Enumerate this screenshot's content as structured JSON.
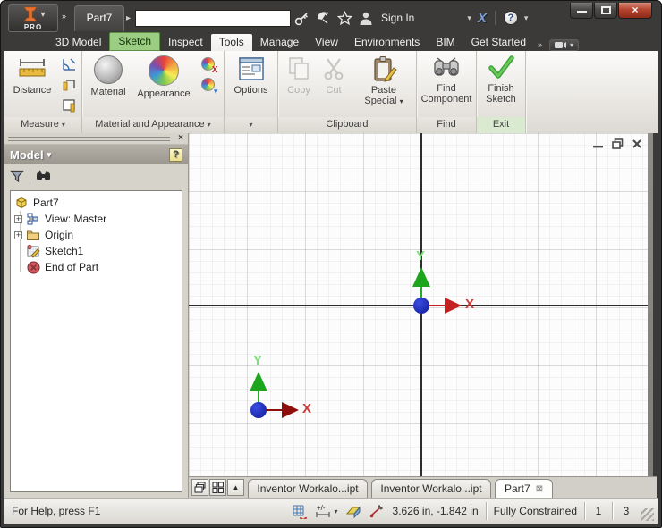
{
  "glyphs": {
    "dropdown": "▾",
    "double_chevron": "»",
    "tab_arrow": "▸",
    "plus": "+",
    "help": "?",
    "exchange_x": "X",
    "close": "×",
    "tab_close": "⊠",
    "up_arrow": "▲"
  },
  "titlebar": {
    "pro": "PRO",
    "doc_tab": "Part7",
    "sign_in": "Sign In"
  },
  "ribbon_tabs": [
    {
      "label": "3D Model"
    },
    {
      "label": "Sketch"
    },
    {
      "label": "Inspect"
    },
    {
      "label": "Tools"
    },
    {
      "label": "Manage"
    },
    {
      "label": "View"
    },
    {
      "label": "Environments"
    },
    {
      "label": "BIM"
    },
    {
      "label": "Get Started"
    }
  ],
  "ribbon": {
    "distance": "Distance",
    "material": "Material",
    "appearance": "Appearance",
    "options": "Options",
    "copy": "Copy",
    "cut": "Cut",
    "paste_special": "Paste Special",
    "find_component": "Find Component",
    "finish_sketch": "Finish Sketch",
    "panel_measure": "Measure",
    "panel_material": "Material and Appearance",
    "panel_clipboard": "Clipboard",
    "panel_find": "Find",
    "panel_exit": "Exit"
  },
  "browser": {
    "title": "Model",
    "tree": [
      {
        "label": "Part7"
      },
      {
        "label": "View: Master"
      },
      {
        "label": "Origin"
      },
      {
        "label": "Sketch1"
      },
      {
        "label": "End of Part"
      }
    ]
  },
  "canvas": {
    "marker_origin": {
      "x": "X",
      "y": "Y"
    },
    "marker_sketch": {
      "x": "X",
      "y": "Y"
    }
  },
  "doc_tabs": [
    {
      "label": "Inventor Workalo...ipt"
    },
    {
      "label": "Inventor Workalo...ipt"
    },
    {
      "label": "Part7"
    }
  ],
  "statusbar": {
    "help": "For Help, press F1",
    "coords": "3.626 in, -1.842 in",
    "constraint": "Fully Constrained",
    "dim_count": "1",
    "doc_count": "3"
  },
  "colors": {
    "sketch_tab_green": "#9bcd83",
    "exit_panel_green": "#d9ead0",
    "axis_x_red": "#c42020",
    "axis_x_dark_red": "#8e0d0d",
    "axis_y_green": "#1ea51e",
    "origin_dot_blue": "#1b2cc1",
    "finish_check_green": "#3aa635",
    "close_button_red": "#b5442f"
  }
}
